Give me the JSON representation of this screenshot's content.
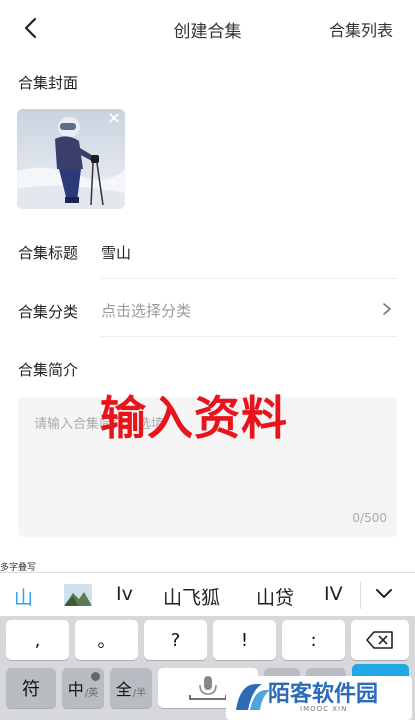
{
  "header": {
    "title": "创建合集",
    "right_link": "合集列表"
  },
  "form": {
    "cover_label": "合集封面",
    "title_label": "合集标题",
    "title_value": "雪山",
    "category_label": "合集分类",
    "category_placeholder": "点击选择分类",
    "intro_label": "合集简介",
    "intro_placeholder": "请输入合集简介，选填",
    "intro_count": "0/500"
  },
  "overlay_text": "输入资料",
  "keyboard": {
    "hint": "多字叠写",
    "candidates": [
      "山",
      "Iv",
      "山飞狐",
      "山贷",
      "IV"
    ],
    "row1": [
      ",",
      "。",
      "?",
      "!",
      ":"
    ],
    "row2": {
      "fu": "符",
      "zhong": "中",
      "zhong_sub": "/英",
      "quan": "全",
      "quan_sub": "/半"
    }
  },
  "watermark": {
    "text": "陌客软件园",
    "sub": "IMOOC XIN"
  },
  "colors": {
    "accent_blue": "#2aa3f5",
    "overlay_red": "#e8141c",
    "watermark_blue": "#2b6bb8"
  }
}
